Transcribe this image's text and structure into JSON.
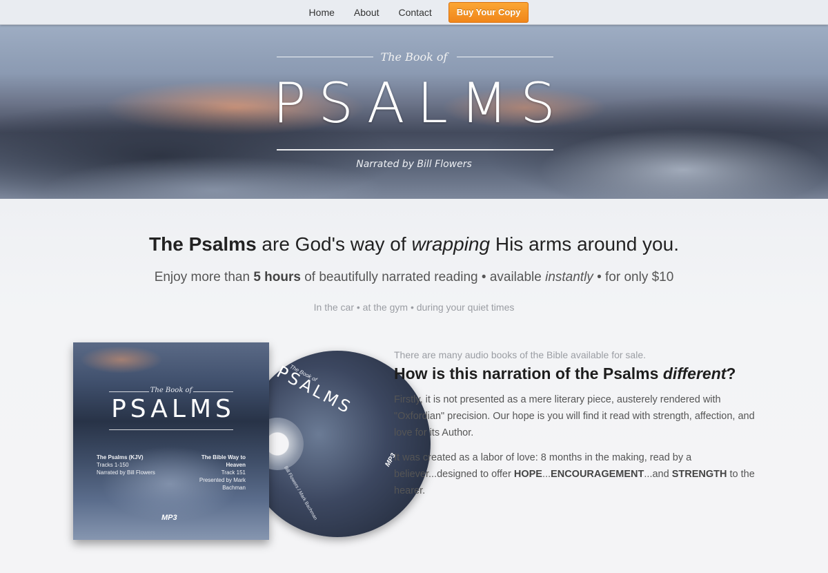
{
  "nav": {
    "links": [
      "Home",
      "About",
      "Contact"
    ],
    "buy_label": "Buy Your Copy"
  },
  "hero": {
    "pre_title": "The Book of",
    "title": "PSALMS",
    "subtitle": "Narrated by Bill Flowers"
  },
  "headline": {
    "part1": "The Psalms",
    "part2": " are God's way of ",
    "part3": "wrapping",
    "part4": " His arms around you."
  },
  "subline": {
    "part1": "Enjoy more than ",
    "part2": "5 hours",
    "part3": " of beautifully narrated reading • available ",
    "part4": "instantly",
    "part5": " • for only $10"
  },
  "tagline": "In the car • at the gym • during your quiet times",
  "product": {
    "case_pre": "The Book of",
    "case_title": "PSALMS",
    "left_title": "The Psalms (KJV)",
    "left_line1": "Tracks 1-150",
    "left_line2": "Narrated by Bill Flowers",
    "right_title": "The Bible Way to Heaven",
    "right_line1": "Track 151",
    "right_line2": "Presented by Mark Bachman",
    "mp3_label": "MP3",
    "disc_pre": "The Book of",
    "disc_title": "PSALMS",
    "disc_credit": "Bill Flowers / Mark Bachman"
  },
  "description": {
    "intro": "There are many audio books of the Bible available for sale.",
    "head_part1": "How is this narration of the Psalms ",
    "head_part2": "different",
    "head_part3": "?",
    "p1": "Firstly, it is not presented as a mere literary piece, austerely rendered with \"Oxfordian\" precision. Our hope is you will find it read with strength, affection, and love for its Author.",
    "p2_part1": "It was created as a labor of love: 8 months in the making, read by a believer...designed to offer ",
    "p2_hope": "HOPE",
    "p2_mid1": "...",
    "p2_enc": "ENCOURAGEMENT",
    "p2_mid2": "...and ",
    "p2_str": "STRENGTH",
    "p2_end": " to the hearer."
  }
}
